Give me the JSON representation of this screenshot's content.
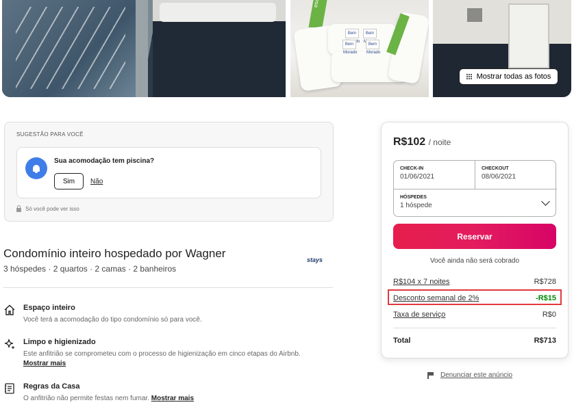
{
  "photos": {
    "show_all_label": "Mostrar todas as fotos",
    "towel_tag_text": "Bem Morado",
    "towel_strip_text": "esa.com"
  },
  "suggestion": {
    "header": "SUGESTÃO PARA VOCÊ",
    "question": "Sua acomodação tem piscina?",
    "yes_label": "Sim",
    "no_label": "Não",
    "privacy_note": "Só você pode ver isso"
  },
  "listing": {
    "title": "Condomínio inteiro hospedado por Wagner",
    "subtitle": "3 hóspedes · 2 quartos · 2 camas · 2 banheiros",
    "host_logo": "stays"
  },
  "features": [
    {
      "title": "Espaço inteiro",
      "desc": "Você terá a acomodação do tipo condomínio só para você.",
      "icon": "home-icon"
    },
    {
      "title": "Limpo e higienizado",
      "desc": "Este anfitrião se comprometeu com o processo de higienização em cinco etapas do Airbnb.",
      "more": "Mostrar mais",
      "icon": "sparkle-icon"
    },
    {
      "title": "Regras da Casa",
      "desc": "O anfitrião não permite festas nem fumar.",
      "more": "Mostrar mais",
      "icon": "rules-book-icon"
    }
  ],
  "booking": {
    "price": "R$102",
    "per_night": "/ noite",
    "checkin_label": "CHECK-IN",
    "checkin_value": "01/06/2021",
    "checkout_label": "CHECKOUT",
    "checkout_value": "08/06/2021",
    "guests_label": "HÓSPEDES",
    "guests_value": "1 hóspede",
    "reserve_label": "Reservar",
    "not_charged": "Você ainda não será cobrado",
    "lines": [
      {
        "label": "R$104 x 7 noites",
        "amount": "R$728"
      },
      {
        "label": "Desconto semanal de 2%",
        "amount": "-R$15"
      },
      {
        "label": "Taxa de serviço",
        "amount": "R$0"
      }
    ],
    "total_label": "Total",
    "total_amount": "R$713"
  },
  "report": {
    "label": "Denunciar este anúncio"
  },
  "colors": {
    "accent": "#e31c5f",
    "discount": "#008a05",
    "highlight_border": "#e0383e",
    "bell_blue": "#3f7ee8"
  }
}
